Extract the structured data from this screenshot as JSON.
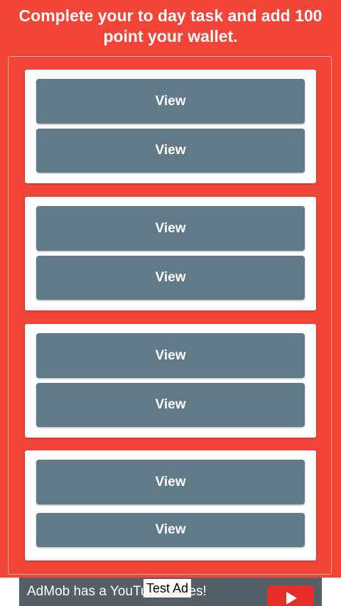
{
  "header": {
    "title_line1": "Complete your to day task and add 100",
    "title_line2": "point your wallet."
  },
  "tasks": [
    {
      "buttons": [
        "View",
        "View"
      ]
    },
    {
      "buttons": [
        "View",
        "View"
      ]
    },
    {
      "buttons": [
        "View",
        "View"
      ]
    },
    {
      "buttons": [
        "View",
        "View"
      ]
    }
  ],
  "ad": {
    "text": "AdMob has a YouTube series!",
    "label": "Test Ad"
  },
  "colors": {
    "background": "#f24537",
    "button": "#617a88",
    "card": "#ffffff",
    "ad_background": "#555f66",
    "youtube_red": "#e52d27"
  }
}
